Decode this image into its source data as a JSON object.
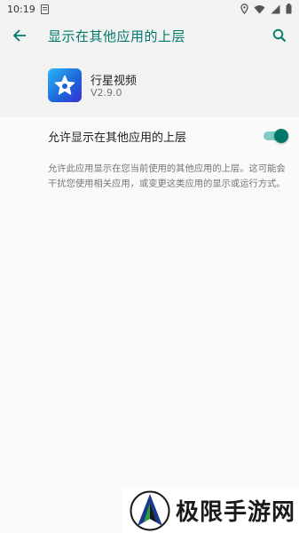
{
  "status_bar": {
    "time": "10:19",
    "icons": [
      "notification-icon",
      "location-icon",
      "wifi-icon",
      "signal-icon",
      "battery-icon"
    ]
  },
  "app_bar": {
    "title": "显示在其他应用的上层",
    "back_icon": "arrow-back-icon",
    "search_icon": "search-icon",
    "accent_color": "#00796b"
  },
  "app_info": {
    "name": "行星视频",
    "version": "V2.9.0",
    "icon": "star-app-icon"
  },
  "preference": {
    "label": "允许显示在其他应用的上层",
    "enabled": true,
    "summary": "允许此应用显示在您当前使用的其他应用的上层。这可能会干扰您使用相关应用，或变更这类应用的显示或运行方式。"
  },
  "watermark": {
    "text": "极限手游网"
  }
}
